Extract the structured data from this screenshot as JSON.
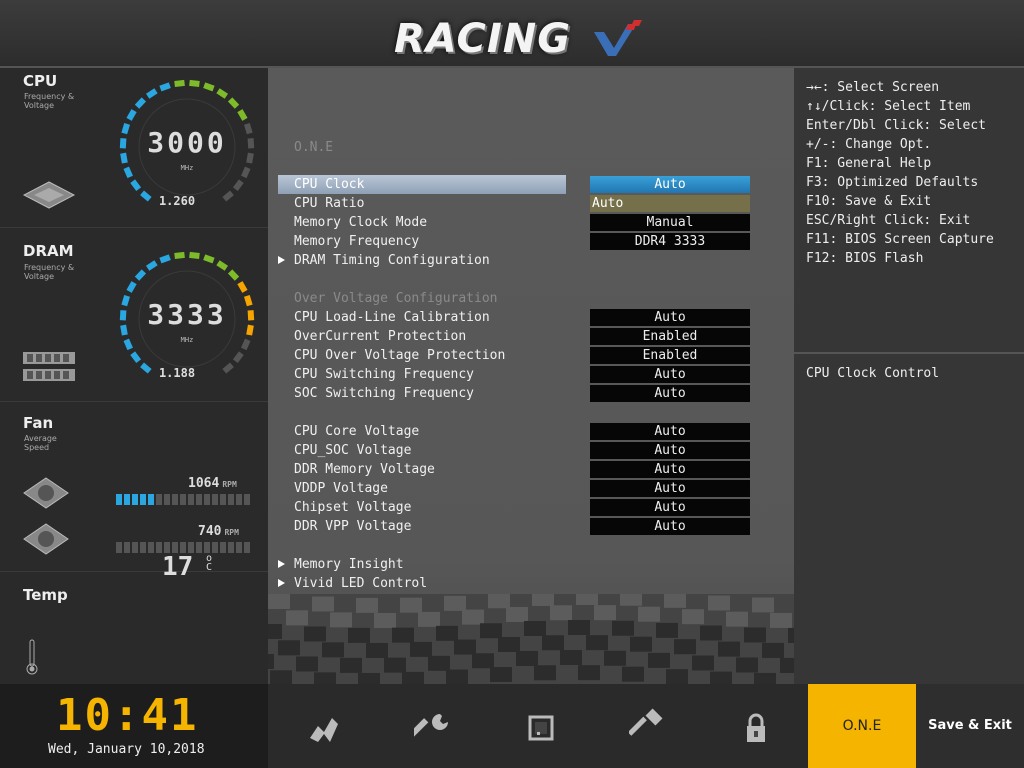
{
  "header": {
    "logo_text": "RACING"
  },
  "left": {
    "cpu": {
      "title": "CPU",
      "sub": "Frequency & Voltage",
      "value": "3000",
      "unit": "MHz",
      "voltage": "1.260"
    },
    "dram": {
      "title": "DRAM",
      "sub": "Frequency & Voltage",
      "value": "3333",
      "unit": "MHz",
      "voltage": "1.188"
    },
    "fan": {
      "title": "Fan",
      "sub": "Average Speed",
      "fans": [
        {
          "rpm": "1064",
          "unit": "RPM",
          "level": 0.3
        },
        {
          "rpm": "740",
          "unit": "RPM",
          "level": 0
        }
      ]
    },
    "temp": {
      "title": "Temp",
      "value": "17",
      "unit_top": "o",
      "unit_bottom": "C"
    }
  },
  "main": {
    "section_title": "O.N.E",
    "rows": [
      {
        "label": "CPU Clock",
        "value": "Auto"
      },
      {
        "label": "CPU Ratio",
        "value": "Auto"
      },
      {
        "label": "Memory Clock Mode",
        "value": "Manual"
      },
      {
        "label": "Memory Frequency",
        "value": "DDR4 3333"
      },
      {
        "label": "DRAM Timing Configuration"
      },
      {
        "label": "Over Voltage Configuration"
      },
      {
        "label": "CPU Load-Line Calibration",
        "value": "Auto"
      },
      {
        "label": "OverCurrent Protection",
        "value": "Enabled"
      },
      {
        "label": "CPU Over Voltage Protection",
        "value": "Enabled"
      },
      {
        "label": "CPU Switching Frequency",
        "value": "Auto"
      },
      {
        "label": "SOC Switching Frequency",
        "value": "Auto"
      },
      {
        "label": "CPU Core Voltage",
        "value": "Auto"
      },
      {
        "label": "CPU_SOC Voltage",
        "value": "Auto"
      },
      {
        "label": "DDR Memory Voltage",
        "value": "Auto"
      },
      {
        "label": "VDDP Voltage",
        "value": "Auto"
      },
      {
        "label": "Chipset Voltage",
        "value": "Auto"
      },
      {
        "label": "DDR VPP Voltage",
        "value": "Auto"
      },
      {
        "label": "Memory Insight"
      },
      {
        "label": "Vivid LED Control"
      }
    ]
  },
  "help": {
    "lines": [
      "→←: Select Screen",
      "↑↓/Click: Select Item",
      "Enter/Dbl Click: Select",
      "+/-: Change Opt.",
      "F1: General Help",
      "F3: Optimized Defaults",
      "F10: Save & Exit",
      "ESC/Right Click: Exit",
      "F11: BIOS Screen Capture",
      "F12: BIOS Flash"
    ],
    "description": "CPU Clock Control"
  },
  "bottom": {
    "time": "10:41",
    "date": "Wed, January  10,2018",
    "tab_one": "O.N.E",
    "tab_save": "Save & Exit",
    "nav_icons": [
      "speedometer-icon",
      "wrench-icon",
      "chip-icon",
      "hammer-icon",
      "lock-icon"
    ]
  },
  "colors": {
    "accent": "#f5b400",
    "highlight_blue": "#2a9ad6",
    "gauge_cyan": "#2aa6e0",
    "gauge_green": "#7dbb2a",
    "gauge_orange": "#f5a400"
  }
}
